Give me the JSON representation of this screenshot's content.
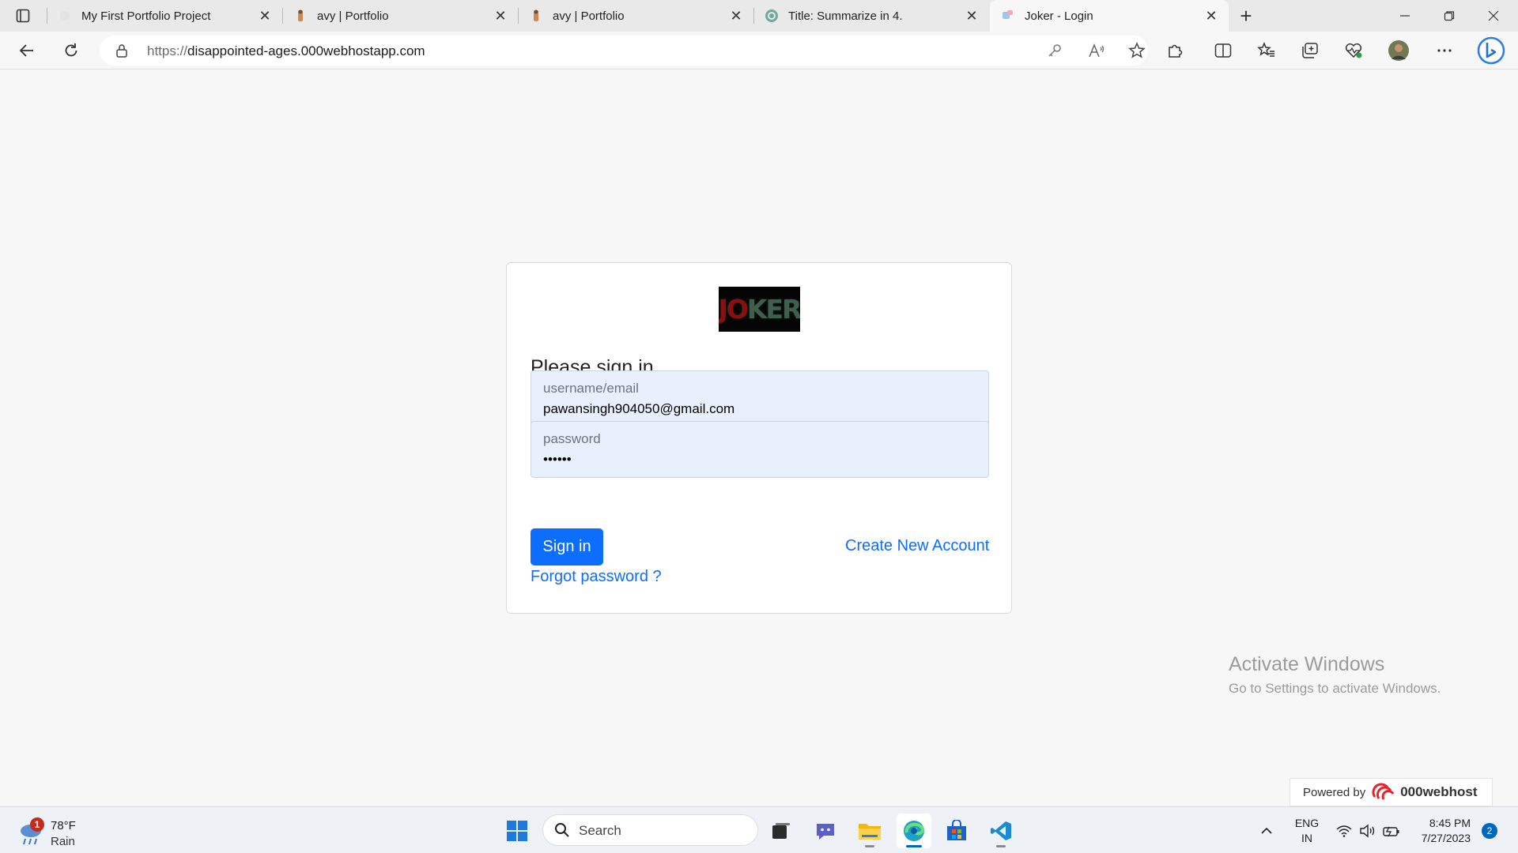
{
  "browser": {
    "tabs": [
      {
        "title": "My First Portfolio Project",
        "favicon": "blank-favicon"
      },
      {
        "title": "avy | Portfolio",
        "favicon": "person-favicon"
      },
      {
        "title": "avy | Portfolio",
        "favicon": "person-favicon"
      },
      {
        "title": "Title: Summarize in 4.",
        "favicon": "chatgpt-favicon"
      },
      {
        "title": "Joker - Login",
        "favicon": "joker-favicon",
        "active": true
      }
    ],
    "address": {
      "scheme": "https://",
      "host": "disappointed-ages.000webhostapp.com"
    }
  },
  "page": {
    "logo_text": {
      "a": "JO",
      "b": "KER"
    },
    "heading": "Please sign in",
    "username": {
      "label": "username/email",
      "value": "pawansingh904050@gmail.com"
    },
    "password": {
      "label": "password",
      "value": "••••••"
    },
    "signin_button": "Sign in",
    "create_account_link": "Create New Account",
    "forgot_password_link": "Forgot password ?",
    "accent_color": "#0d6efd"
  },
  "watermark": {
    "title": "Activate Windows",
    "subtitle": "Go to Settings to activate Windows."
  },
  "powered": {
    "prefix": "Powered by",
    "brand": "000webhost"
  },
  "taskbar": {
    "weather": {
      "temp": "78°F",
      "condition": "Rain",
      "alerts": "1"
    },
    "search_placeholder": "Search",
    "language": {
      "line1": "ENG",
      "line2": "IN"
    },
    "clock": {
      "time": "8:45 PM",
      "date": "7/27/2023"
    },
    "notifications": "2"
  }
}
